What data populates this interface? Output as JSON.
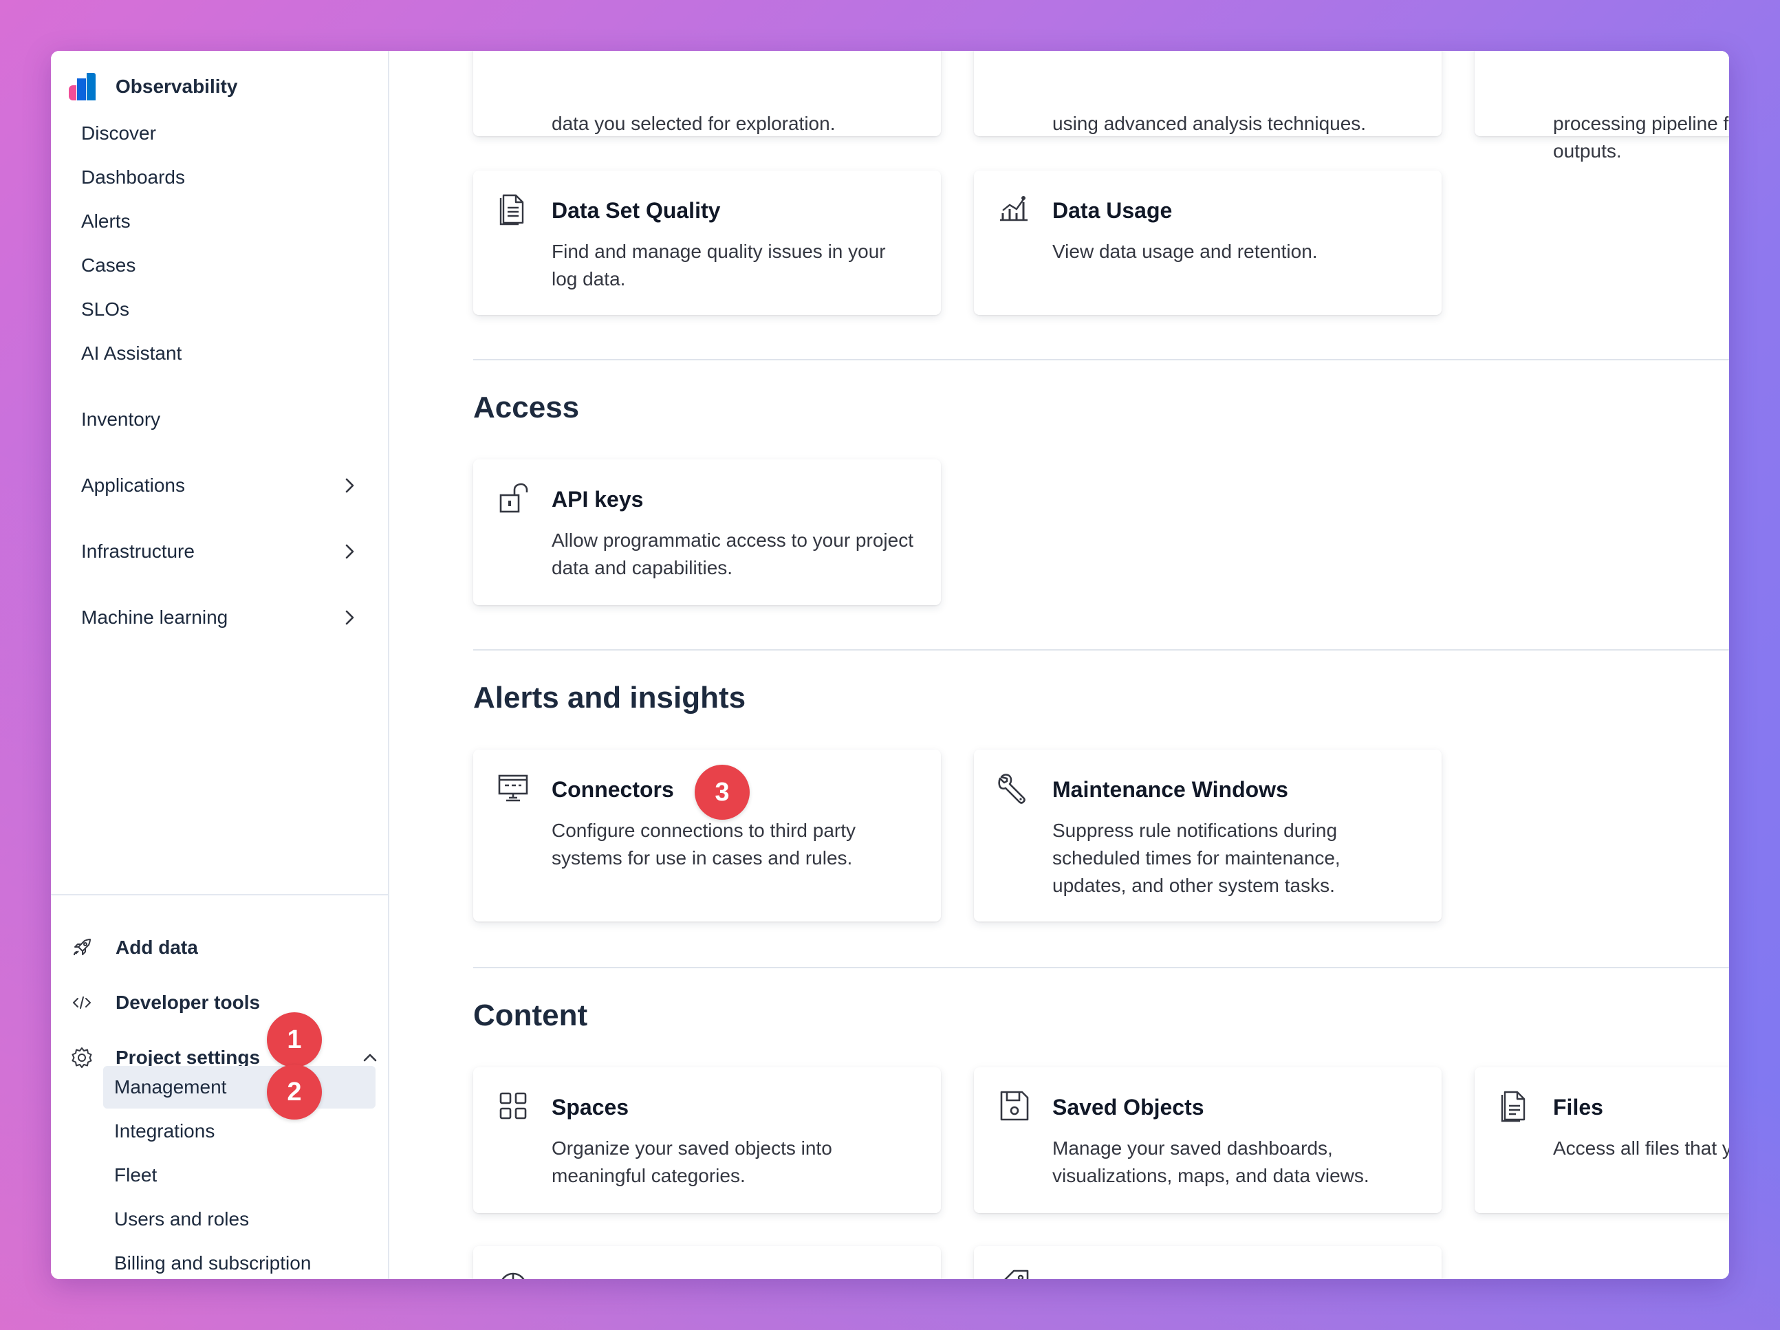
{
  "sidebar": {
    "brand": "Observability",
    "items": [
      {
        "label": "Discover"
      },
      {
        "label": "Dashboards"
      },
      {
        "label": "Alerts"
      },
      {
        "label": "Cases"
      },
      {
        "label": "SLOs"
      },
      {
        "label": "AI Assistant"
      },
      {
        "label": "Inventory"
      },
      {
        "label": "Applications"
      },
      {
        "label": "Infrastructure"
      },
      {
        "label": "Machine learning"
      }
    ],
    "footer": {
      "add_data": "Add data",
      "developer_tools": "Developer tools",
      "project_settings": "Project settings",
      "sub_items": [
        {
          "label": "Management"
        },
        {
          "label": "Integrations"
        },
        {
          "label": "Fleet"
        },
        {
          "label": "Users and roles"
        },
        {
          "label": "Billing and subscription"
        }
      ]
    }
  },
  "annotations": {
    "step1": "1",
    "step2": "2",
    "step3": "3",
    "color": "#e8424a"
  },
  "main": {
    "top_cards": [
      {
        "desc": "data you selected for exploration."
      },
      {
        "desc": "using advanced analysis techniques."
      },
      {
        "desc": "processing pipeline from outputs."
      }
    ],
    "data_cards": [
      {
        "title": "Data Set Quality",
        "desc": "Find and manage quality issues in your log data.",
        "icon": "document-icon"
      },
      {
        "title": "Data Usage",
        "desc": "View data usage and retention.",
        "icon": "usage-chart-icon"
      }
    ],
    "access": {
      "title": "Access",
      "cards": [
        {
          "title": "API keys",
          "desc": "Allow programmatic access to your project data and capabilities.",
          "icon": "unlock-icon"
        }
      ]
    },
    "alerts": {
      "title": "Alerts and insights",
      "cards": [
        {
          "title": "Connectors",
          "desc": "Configure connections to third party systems for use in cases and rules.",
          "icon": "monitor-icon"
        },
        {
          "title": "Maintenance Windows",
          "desc": "Suppress rule notifications during scheduled times for maintenance, updates, and other system tasks.",
          "icon": "wrench-icon"
        }
      ]
    },
    "content": {
      "title": "Content",
      "cards": [
        {
          "title": "Spaces",
          "desc": "Organize your saved objects into meaningful categories.",
          "icon": "grid-icon"
        },
        {
          "title": "Saved Objects",
          "desc": "Manage your saved dashboards, visualizations, maps, and data views.",
          "icon": "save-icon"
        },
        {
          "title": "Files",
          "desc": "Access all files that you u",
          "icon": "file-icon"
        }
      ]
    }
  }
}
